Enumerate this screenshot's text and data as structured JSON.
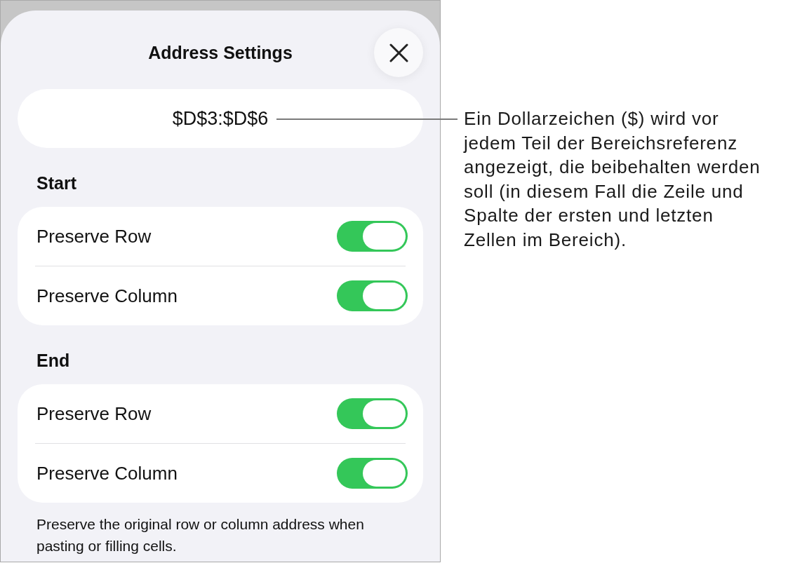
{
  "sheet": {
    "title": "Address Settings",
    "address": "$D$3:$D$6",
    "sections": [
      {
        "header": "Start",
        "rows": [
          {
            "label": "Preserve Row",
            "on": true
          },
          {
            "label": "Preserve Column",
            "on": true
          }
        ]
      },
      {
        "header": "End",
        "rows": [
          {
            "label": "Preserve Row",
            "on": true
          },
          {
            "label": "Preserve Column",
            "on": true
          }
        ]
      }
    ],
    "footnote": "Preserve the original row or column address when pasting or filling cells."
  },
  "callout": {
    "text": "Ein Dollarzeichen ($) wird vor jedem Teil der Bereichsreferenz angezeigt, die beibehalten werden soll (in diesem Fall die Zeile und Spalte der ersten und letzten Zellen im Bereich)."
  }
}
